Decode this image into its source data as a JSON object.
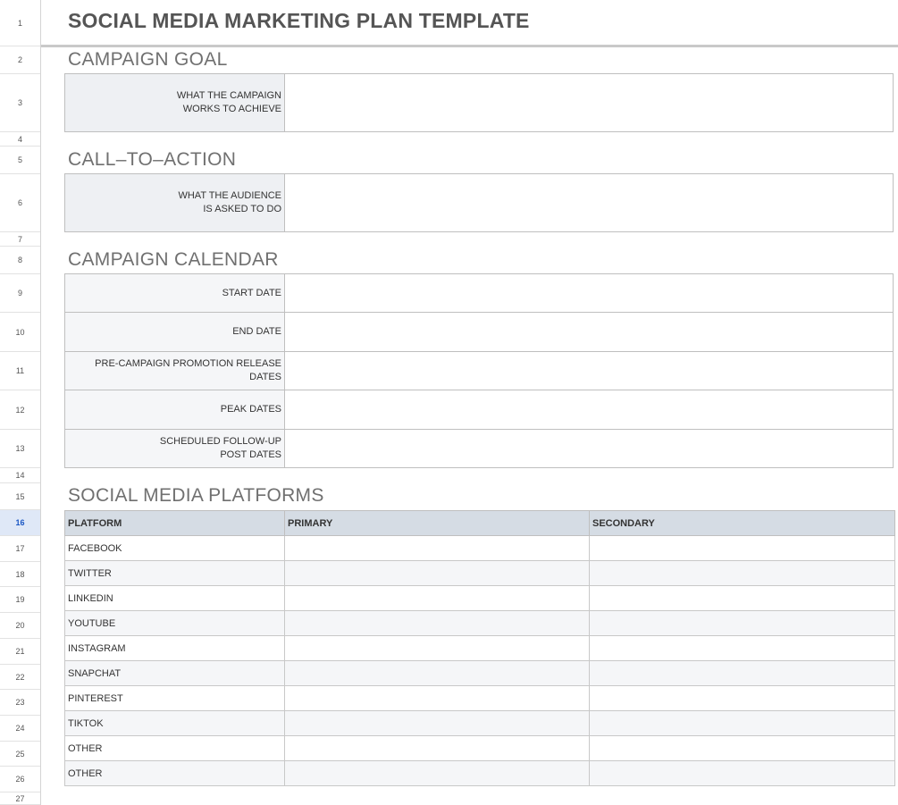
{
  "rows": [
    "1",
    "2",
    "3",
    "4",
    "5",
    "6",
    "7",
    "8",
    "9",
    "10",
    "11",
    "12",
    "13",
    "14",
    "15",
    "16",
    "17",
    "18",
    "19",
    "20",
    "21",
    "22",
    "23",
    "24",
    "25",
    "26",
    "27"
  ],
  "title": "SOCIAL MEDIA MARKETING PLAN TEMPLATE",
  "campaign_goal": {
    "heading": "CAMPAIGN GOAL",
    "label_line1": "WHAT THE CAMPAIGN",
    "label_line2": "WORKS TO ACHIEVE",
    "value": ""
  },
  "call_to_action": {
    "heading": "CALL–TO–ACTION",
    "label_line1": "WHAT THE AUDIENCE",
    "label_line2": "IS ASKED TO DO",
    "value": ""
  },
  "calendar": {
    "heading": "CAMPAIGN CALENDAR",
    "items": [
      {
        "line1": "START DATE",
        "line2": "",
        "value": ""
      },
      {
        "line1": "END DATE",
        "line2": "",
        "value": ""
      },
      {
        "line1": "PRE-CAMPAIGN PROMOTION RELEASE",
        "line2": "DATES",
        "value": ""
      },
      {
        "line1": "PEAK DATES",
        "line2": "",
        "value": ""
      },
      {
        "line1": "SCHEDULED FOLLOW-UP",
        "line2": "POST DATES",
        "value": ""
      }
    ]
  },
  "platforms": {
    "heading": "SOCIAL MEDIA PLATFORMS",
    "columns": [
      "PLATFORM",
      "PRIMARY",
      "SECONDARY"
    ],
    "rows": [
      {
        "platform": "FACEBOOK",
        "primary": "",
        "secondary": ""
      },
      {
        "platform": "TWITTER",
        "primary": "",
        "secondary": ""
      },
      {
        "platform": "LINKEDIN",
        "primary": "",
        "secondary": ""
      },
      {
        "platform": "YOUTUBE",
        "primary": "",
        "secondary": ""
      },
      {
        "platform": "INSTAGRAM",
        "primary": "",
        "secondary": ""
      },
      {
        "platform": "SNAPCHAT",
        "primary": "",
        "secondary": ""
      },
      {
        "platform": "PINTEREST",
        "primary": "",
        "secondary": ""
      },
      {
        "platform": "TIKTOK",
        "primary": "",
        "secondary": ""
      },
      {
        "platform": "OTHER",
        "primary": "",
        "secondary": ""
      },
      {
        "platform": "OTHER",
        "primary": "",
        "secondary": ""
      }
    ]
  },
  "colors": {
    "header_fill": "#d5dce4",
    "label_fill": "#eef0f3",
    "active_row": "#dfe8f7"
  }
}
